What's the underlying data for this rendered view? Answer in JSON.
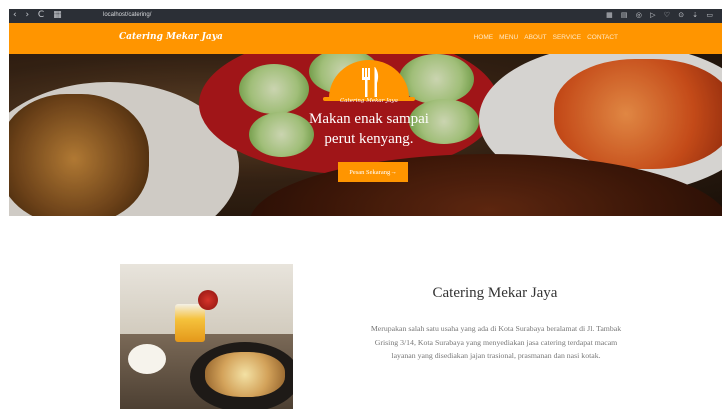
{
  "browser": {
    "url": "localhost/catering/",
    "nav_icons": "‹ › C ▦",
    "toolbar_icons": "▦ ▤ ◎ ▷ ♡ ⊙ ⇣ ▭"
  },
  "navbar": {
    "brand": "Catering Mekar Jaya",
    "links": [
      "HOME",
      "MENU",
      "ABOUT",
      "SERVICE",
      "CONTACT"
    ]
  },
  "hero": {
    "logo_text": "Catering Mekar Jaya",
    "tagline": "Makan enak sampai perut kenyang.",
    "cta_label": "Pesan Sekarang→"
  },
  "about": {
    "title": "Catering Mekar Jaya",
    "description": "Merupakan salah satu usaha yang ada di Kota Surabaya beralamat di Jl. Tambak Grising 3/14, Kota Surabaya yang menyediakan jasa catering terdapat macam layanan yang disediakan jajan trasional, prasmanan dan nasi kotak."
  },
  "colors": {
    "accent": "#ff9500",
    "browser_bar": "#2b2f36"
  },
  "icons": {
    "logo": "fork-knife-cloche-icon"
  }
}
